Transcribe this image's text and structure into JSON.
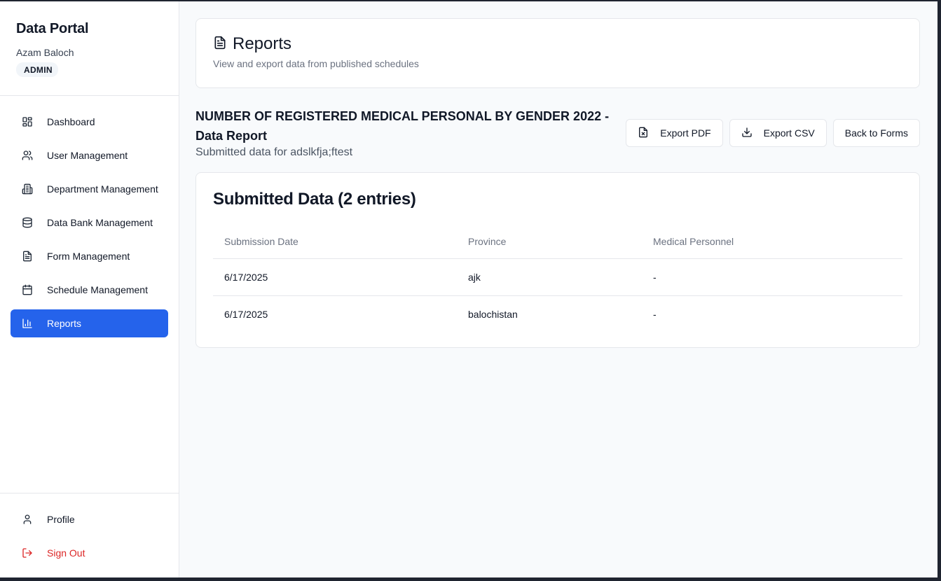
{
  "sidebar": {
    "brand": "Data Portal",
    "user": "Azam Baloch",
    "role": "ADMIN",
    "items": [
      {
        "label": "Dashboard",
        "icon": "dashboard-icon"
      },
      {
        "label": "User Management",
        "icon": "users-icon"
      },
      {
        "label": "Department Management",
        "icon": "building-icon"
      },
      {
        "label": "Data Bank Management",
        "icon": "database-icon"
      },
      {
        "label": "Form Management",
        "icon": "file-text-icon"
      },
      {
        "label": "Schedule Management",
        "icon": "calendar-icon"
      },
      {
        "label": "Reports",
        "icon": "bar-chart-icon",
        "active": true
      }
    ],
    "bottom": [
      {
        "label": "Profile",
        "icon": "user-icon"
      },
      {
        "label": "Sign Out",
        "icon": "sign-out-icon"
      }
    ]
  },
  "header": {
    "title": "Reports",
    "subtitle": "View and export data from published schedules"
  },
  "report": {
    "title": "NUMBER OF REGISTERED MEDICAL PERSONAL BY GENDER 2022 - Data Report",
    "subtitle": "Submitted data for adslkfja;ftest",
    "actions": {
      "export_pdf": "Export PDF",
      "export_csv": "Export CSV",
      "back": "Back to Forms"
    }
  },
  "table": {
    "title": "Submitted Data (2 entries)",
    "columns": [
      "Submission Date",
      "Province",
      "Medical Personnel"
    ],
    "rows": [
      [
        "6/17/2025",
        "ajk",
        "-"
      ],
      [
        "6/17/2025",
        "balochistan",
        "-"
      ]
    ]
  },
  "colors": {
    "accent": "#2563eb",
    "danger": "#dc2626"
  }
}
